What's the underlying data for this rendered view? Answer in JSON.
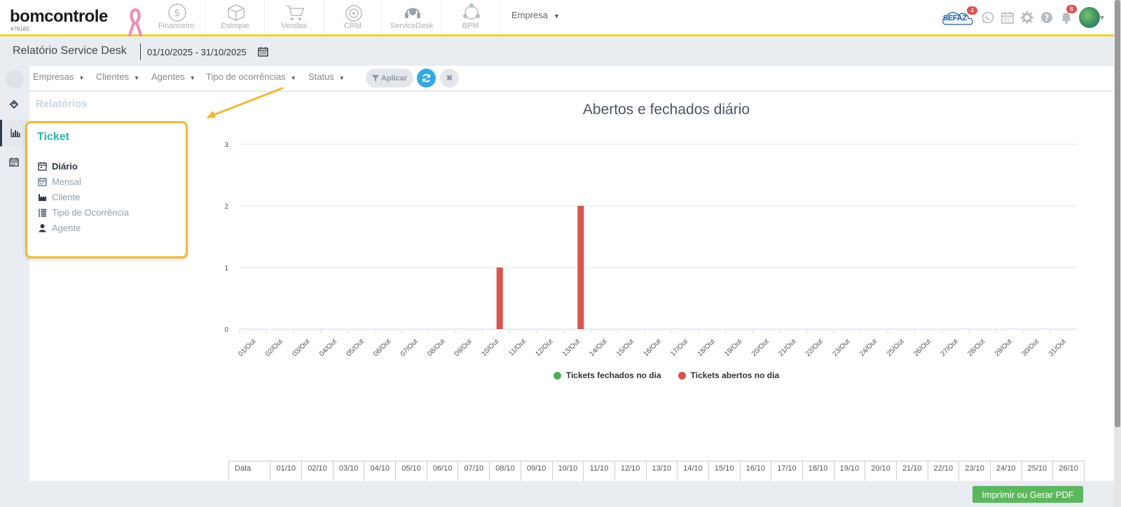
{
  "app": {
    "logo_text": "bomcontrole",
    "account_code": "#76165",
    "modules": [
      {
        "label": "Financeiro",
        "icon": "dollar-icon"
      },
      {
        "label": "Estoque",
        "icon": "box-icon"
      },
      {
        "label": "Vendas",
        "icon": "cart-icon"
      },
      {
        "label": "CRM",
        "icon": "target-icon"
      },
      {
        "label": "ServiceDesk",
        "icon": "headset-icon"
      },
      {
        "label": "BPM",
        "icon": "network-icon"
      }
    ],
    "company_menu": "Empresa",
    "sefaz_label": "SEFAZ",
    "sefaz_badge": "4",
    "notifications_badge": "8"
  },
  "page": {
    "title": "Relatório Service Desk",
    "date_range": "01/10/2025 - 31/10/2025"
  },
  "filters": {
    "items": [
      "Empresas",
      "Clientes",
      "Agentes",
      "Tipo de ocorrências",
      "Status"
    ],
    "apply_label": "Aplicar"
  },
  "sidebar": {
    "section_title": "Relatórios",
    "group_title": "Ticket",
    "items": [
      {
        "label": "Diário",
        "icon": "calendar-day-icon",
        "active": true
      },
      {
        "label": "Mensal",
        "icon": "calendar-icon",
        "active": false
      },
      {
        "label": "Cliente",
        "icon": "factory-icon",
        "active": false
      },
      {
        "label": "Tipo de Ocorrência",
        "icon": "list-icon",
        "active": false
      },
      {
        "label": "Agente",
        "icon": "user-icon",
        "active": false
      }
    ]
  },
  "chart_data": {
    "type": "bar",
    "title": "Abertos e fechados diário",
    "categories": [
      "01/Out",
      "02/Out",
      "03/Out",
      "04/Out",
      "05/Out",
      "06/Out",
      "07/Out",
      "08/Out",
      "09/Out",
      "10/Out",
      "11/Out",
      "12/Out",
      "13/Out",
      "14/Out",
      "15/Out",
      "16/Out",
      "17/Out",
      "18/Out",
      "19/Out",
      "20/Out",
      "21/Out",
      "22/Out",
      "23/Out",
      "24/Out",
      "25/Out",
      "26/Out",
      "27/Out",
      "28/Out",
      "29/Out",
      "30/Out",
      "31/Out"
    ],
    "series": [
      {
        "name": "Tickets fechados no dia",
        "color": "#4caf50",
        "values": [
          0,
          0,
          0,
          0,
          0,
          0,
          0,
          0,
          0,
          0,
          0,
          0,
          0,
          0,
          0,
          0,
          0,
          0,
          0,
          0,
          0,
          0,
          0,
          0,
          0,
          0,
          0,
          0,
          0,
          0,
          0
        ]
      },
      {
        "name": "Tickets abertos no dia",
        "color": "#d9534f",
        "values": [
          0,
          0,
          0,
          0,
          0,
          0,
          0,
          0,
          0,
          1,
          0,
          0,
          2,
          0,
          0,
          0,
          0,
          0,
          0,
          0,
          0,
          0,
          0,
          0,
          0,
          0,
          0,
          0,
          0,
          0,
          0
        ]
      }
    ],
    "ylim": [
      0,
      3
    ],
    "yticks": [
      0,
      1,
      2,
      3
    ],
    "grid": true,
    "legend_position": "bottom"
  },
  "table": {
    "header_first": "Data",
    "columns": [
      "01/10",
      "02/10",
      "03/10",
      "04/10",
      "05/10",
      "06/10",
      "07/10",
      "08/10",
      "09/10",
      "10/10",
      "11/10",
      "12/10",
      "13/10",
      "14/10",
      "15/10",
      "16/10",
      "17/10",
      "18/10",
      "19/10",
      "20/10",
      "21/10",
      "22/10",
      "23/10",
      "24/10",
      "25/10",
      "26/10"
    ]
  },
  "actions": {
    "print_label": "Imprimir ou Gerar PDF"
  },
  "colors": {
    "accent_yellow": "#f2d229",
    "teal": "#29b3a8",
    "highlight_orange": "#f0b93b",
    "print_green": "#5cb85c",
    "refresh_blue": "#36a9e0"
  }
}
